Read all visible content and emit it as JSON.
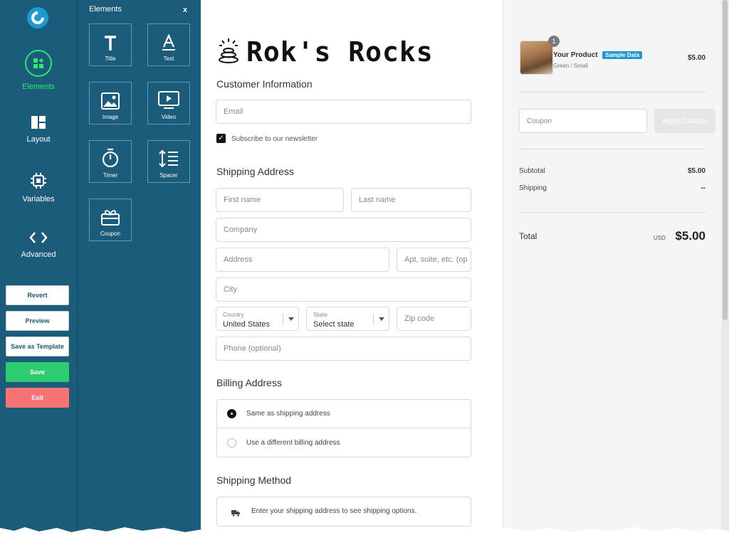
{
  "nav": {
    "items": [
      {
        "label": "Elements",
        "icon": "elements-icon",
        "active": true
      },
      {
        "label": "Layout",
        "icon": "layout-icon"
      },
      {
        "label": "Variables",
        "icon": "chip-icon"
      },
      {
        "label": "Advanced",
        "icon": "code-icon"
      }
    ],
    "buttons": {
      "revert": "Revert",
      "preview": "Preview",
      "save_template": "Save as Template",
      "save": "Save",
      "exit": "Exit"
    }
  },
  "panel": {
    "title": "Elements",
    "close": "x",
    "tiles": [
      {
        "label": "Title",
        "icon": "title-icon"
      },
      {
        "label": "Text",
        "icon": "text-icon"
      },
      {
        "label": "Image",
        "icon": "image-icon"
      },
      {
        "label": "Video",
        "icon": "video-icon"
      },
      {
        "label": "Timer",
        "icon": "timer-icon"
      },
      {
        "label": "Spacer",
        "icon": "spacer-icon"
      },
      {
        "label": "Coupon",
        "icon": "coupon-icon"
      }
    ]
  },
  "form": {
    "brand": "Rok's Rocks",
    "customer_info": "Customer Information",
    "email_placeholder": "Email",
    "newsletter": "Subscribe to our newsletter",
    "shipping_address": "Shipping Address",
    "first_name": "First name",
    "last_name": "Last name",
    "company": "Company",
    "address": "Address",
    "apt": "Apt, suite, etc. (op",
    "city": "City",
    "country_label": "Country",
    "country_value": "United States",
    "state_label": "State",
    "state_value": "Select state",
    "zip": "Zip code",
    "phone": "Phone (optional)",
    "billing_address": "Billing Address",
    "billing_same": "Same as shipping address",
    "billing_diff": "Use a different billing address",
    "shipping_method": "Shipping Method",
    "shipping_note": "Enter your shipping address to see shipping options."
  },
  "summary": {
    "qty": "1",
    "product_name": "Your Product",
    "badge": "Sample Data",
    "variant": "Green / Small",
    "price": "$5.00",
    "coupon_placeholder": "Coupon",
    "apply_coupon": "Apply Coupon",
    "subtotal_label": "Subtotal",
    "subtotal_value": "$5.00",
    "shipping_label": "Shipping",
    "shipping_value": "--",
    "total_label": "Total",
    "currency": "USD",
    "total_value": "$5.00"
  }
}
